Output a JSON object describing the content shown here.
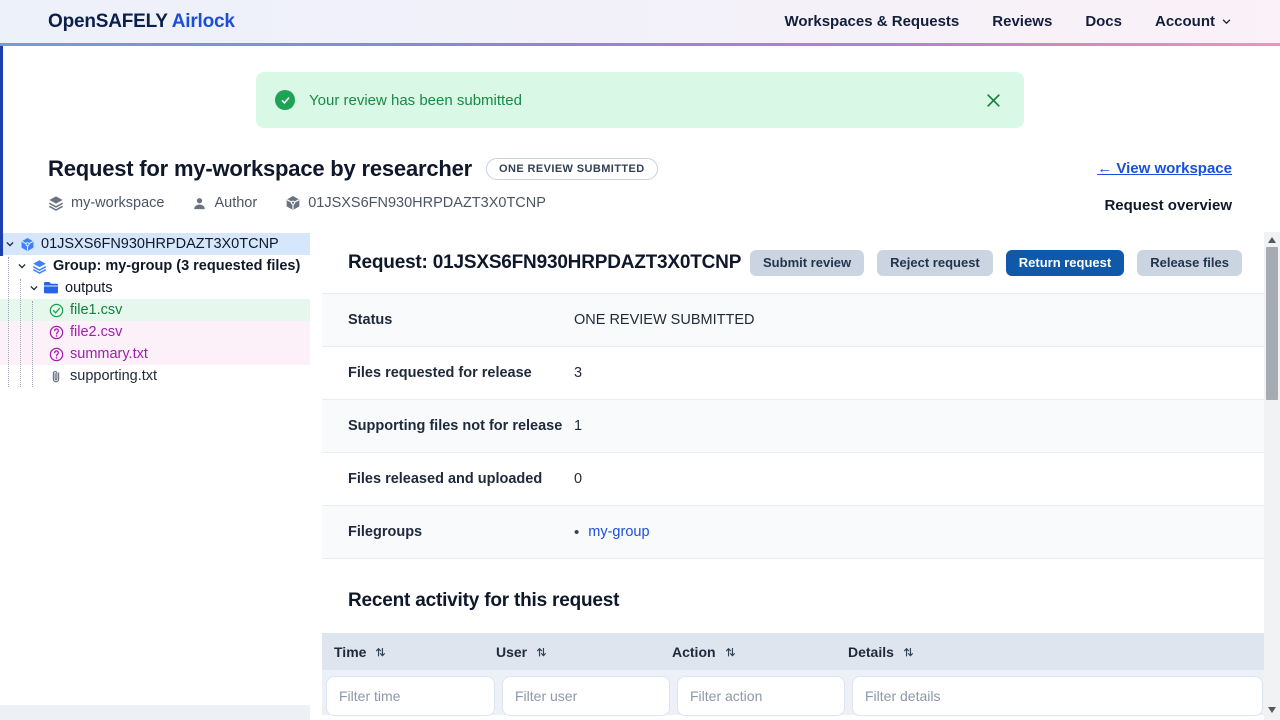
{
  "header": {
    "brand_primary": "OpenSAFELY",
    "brand_secondary": "Airlock",
    "nav": [
      {
        "label": "Workspaces & Requests"
      },
      {
        "label": "Reviews"
      },
      {
        "label": "Docs"
      },
      {
        "label": "Account",
        "has_dropdown": true
      }
    ]
  },
  "alert": {
    "message": "Your review has been submitted",
    "icon": "check-circle-icon",
    "close_icon": "close-icon"
  },
  "page": {
    "title": "Request for my-workspace by researcher",
    "status_badge": "ONE REVIEW SUBMITTED",
    "back_link": "← View workspace",
    "overview_label": "Request overview",
    "meta": [
      {
        "icon": "layers-icon",
        "label": "my-workspace"
      },
      {
        "icon": "user-icon",
        "label": "Author"
      },
      {
        "icon": "cube-icon",
        "label": "01JSXS6FN930HRPDAZT3X0TCNP"
      }
    ]
  },
  "tree": {
    "items": [
      {
        "label": "01JSXS6FN930HRPDAZT3X0TCNP",
        "icon": "cube-icon",
        "expanded": true,
        "selected": true
      },
      {
        "label": "Group: my-group (3 requested files)",
        "icon": "layers-icon",
        "expanded": true
      },
      {
        "label": "outputs",
        "icon": "folder-icon",
        "expanded": true
      },
      {
        "label": "file1.csv",
        "icon": "check-circle-icon",
        "status": "approved"
      },
      {
        "label": "file2.csv",
        "icon": "question-circle-icon",
        "status": "undecided"
      },
      {
        "label": "summary.txt",
        "icon": "question-circle-icon",
        "status": "undecided"
      },
      {
        "label": "supporting.txt",
        "icon": "paperclip-icon",
        "status": "supporting"
      }
    ]
  },
  "request_panel": {
    "title": "Request: 01JSXS6FN930HRPDAZT3X0TCNP",
    "buttons": [
      {
        "label": "Submit review",
        "style": "secondary"
      },
      {
        "label": "Reject request",
        "style": "secondary"
      },
      {
        "label": "Return request",
        "style": "primary"
      },
      {
        "label": "Release files",
        "style": "secondary"
      }
    ],
    "details": [
      {
        "label": "Status",
        "value": "ONE REVIEW SUBMITTED"
      },
      {
        "label": "Files requested for release",
        "value": "3"
      },
      {
        "label": "Supporting files not for release",
        "value": "1"
      },
      {
        "label": "Files released and uploaded",
        "value": "0"
      },
      {
        "label": "Filegroups",
        "value": "my-group",
        "is_link": true,
        "bullet": "•"
      }
    ]
  },
  "activity": {
    "title": "Recent activity for this request",
    "columns": [
      {
        "label": "Time",
        "filter_placeholder": "Filter time",
        "sortable": true
      },
      {
        "label": "User",
        "filter_placeholder": "Filter user",
        "sortable": true
      },
      {
        "label": "Action",
        "filter_placeholder": "Filter action",
        "sortable": true
      },
      {
        "label": "Details",
        "filter_placeholder": "Filter details",
        "sortable": true
      }
    ]
  },
  "colors": {
    "brand_blue": "#1d4ed8",
    "nav_text": "#13203c",
    "accent_gradient": [
      "#6f9fd8",
      "#8e85d6",
      "#ee93bd"
    ],
    "alert_bg": "#daf8e6",
    "alert_text": "#178a45",
    "primary_button": "#1058a8",
    "secondary_button": "#cbd5e1",
    "link": "#1d4ed8",
    "selected_row": "#d7e7fb",
    "approved_text": "#15803d",
    "approved_bg": "#e6f8ee",
    "undecided_text": "#a21caf",
    "undecided_bg": "#fdf1f9",
    "table_header_bg": "#dfe5ef",
    "filter_row_bg": "#ecf1f7"
  }
}
